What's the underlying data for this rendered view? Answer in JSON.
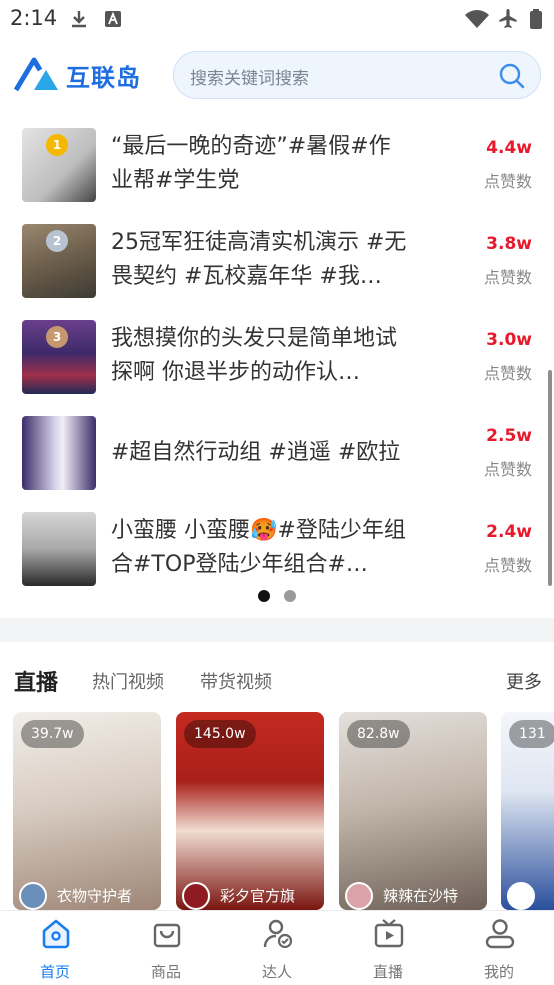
{
  "status_bar": {
    "time": "2:14"
  },
  "header": {
    "logo_text": "互联岛",
    "search_placeholder": "搜索关键词搜索"
  },
  "ranking": [
    {
      "rank": "1",
      "title": "“最后一晚的奇迹”#暑假#作业帮#学生党",
      "count": "4.4w",
      "count_label": "点赞数",
      "badge_color": "#f5b800",
      "thumb_colors": [
        "#dcdcdc",
        "#444"
      ]
    },
    {
      "rank": "2",
      "title": "25冠军狂徒高清实机演示 #无畏契约 #瓦校嘉年华 #我…",
      "count": "3.8w",
      "count_label": "点赞数",
      "badge_color": "#b8c3d1",
      "thumb_colors": [
        "#7a6a55",
        "#3d3a33"
      ]
    },
    {
      "rank": "3",
      "title": "我想摸你的头发只是简单地试探啊 你退半步的动作认…",
      "count": "3.0w",
      "count_label": "点赞数",
      "badge_color": "#c69870",
      "thumb_colors": [
        "#5a3a78",
        "#1f2a55"
      ]
    },
    {
      "rank": "",
      "title": "#超自然行动组 #逍遥 #欧拉",
      "count": "2.5w",
      "count_label": "点赞数",
      "badge_color": "",
      "thumb_colors": [
        "#e6e6f2",
        "#3c2d6a"
      ]
    },
    {
      "rank": "",
      "title": "小蛮腰 小蛮腰🥵#登陆少年组合#TOP登陆少年组合#…",
      "count": "2.4w",
      "count_label": "点赞数",
      "badge_color": "",
      "thumb_colors": [
        "#c8c8c8",
        "#2a2a2a"
      ]
    }
  ],
  "live_section": {
    "tabs": [
      "直播",
      "热门视频",
      "带货视频"
    ],
    "more": "更多",
    "cards": [
      {
        "viewers": "39.7w",
        "host": "衣物守护者",
        "colors": [
          "#e8e2dc",
          "#b59f8f"
        ]
      },
      {
        "viewers": "145.0w",
        "host": "彩夕官方旗",
        "colors": [
          "#c3281f",
          "#7a1510"
        ]
      },
      {
        "viewers": "82.8w",
        "host": "辣辣在沙特",
        "colors": [
          "#d9d4cf",
          "#8a7c70"
        ]
      },
      {
        "viewers": "131",
        "host": "",
        "colors": [
          "#f4f6fa",
          "#2b4f9c"
        ]
      }
    ]
  },
  "bottom_nav": [
    {
      "label": "首页",
      "icon": "home-icon",
      "active": true
    },
    {
      "label": "商品",
      "icon": "shopping-bag-icon",
      "active": false
    },
    {
      "label": "达人",
      "icon": "expert-user-icon",
      "active": false
    },
    {
      "label": "直播",
      "icon": "live-tv-icon",
      "active": false
    },
    {
      "label": "我的",
      "icon": "profile-icon",
      "active": false
    }
  ],
  "colors": {
    "accent": "#1a7ef0",
    "count_red": "#e8192c"
  }
}
